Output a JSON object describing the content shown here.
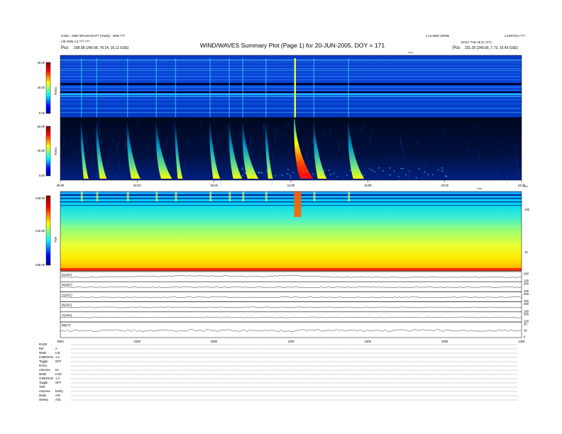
{
  "header": {
    "title": "WIND/WAVES Summary Plot (Page 1) for 20-JUN-2005, DOY = 171",
    "left_line1": "0.030 = 2000 SPACECRAFT (Yearly) - 2005 ???",
    "left_line2": "A/E 2005 2.3 ??? ???",
    "left_pos_label": "Pos",
    "left_pos_value": "238.08 (240.58, 78.14, 16.11 GSE)",
    "right_line1": "1.13 WED 22FEB",
    "right_line1b": "L3 EPOCH ???",
    "right_line2": "DAILY TUE 28 (3, 3??)",
    "right_pos_label": "Pos",
    "right_pos_value": "231.25 (240.66, 7.73, 16.43 GSE)"
  },
  "panels": {
    "rad2": {
      "label": "RAD2",
      "units": "MHz"
    },
    "rad1": {
      "label": "RAD1",
      "units": "kHz"
    },
    "tnr": {
      "label": "TNR",
      "units": "kHz"
    }
  },
  "plot_labels": {
    "rad1_top": "???",
    "tnr_top": "???",
    "rad1_right_top": "???"
  },
  "chart_data": [
    {
      "type": "heatmap",
      "name": "RAD2",
      "ylabel": "RAD2",
      "colorbar_ticks": [
        "40.00",
        "20.00",
        "0.00"
      ],
      "colorbar_range": [
        0,
        40
      ],
      "colors": [
        "#000080",
        "#0000ff",
        "#00ffff",
        "#ffff00",
        "#ff0000",
        "#800000"
      ]
    },
    {
      "type": "heatmap",
      "name": "RAD1",
      "ylabel": "RAD1",
      "colorbar_ticks": [
        "60.00",
        "30.00",
        "0.00"
      ],
      "colorbar_range": [
        0,
        60
      ],
      "x_ticks": [
        "00:00",
        "04:00",
        "08:00",
        "12:00",
        "16:00",
        "20:00",
        "24:00"
      ],
      "burst_hours": [
        1.1,
        1.9,
        3.5,
        5.0,
        6.0,
        7.8,
        8.8,
        9.5,
        10.7,
        12.2,
        13.2,
        15.0
      ]
    },
    {
      "type": "heatmap",
      "name": "TNR",
      "ylabel": "TNR",
      "colorbar_ticks": [
        "-130.00",
        "-142.50",
        "-155.00"
      ],
      "colorbar_range": [
        -155,
        -130
      ],
      "right_ticks": [
        "100",
        "10"
      ]
    },
    {
      "type": "line",
      "name": "stack",
      "rows": [
        {
          "label": "E(ADC)",
          "right": [
            "200",
            "100"
          ]
        },
        {
          "label": "D(ADC)",
          "right": [
            "200",
            "100"
          ]
        },
        {
          "label": "C(ADC)",
          "right": [
            "200",
            "100"
          ]
        },
        {
          "label": "B(ADC)",
          "right": [
            "200",
            "100"
          ]
        },
        {
          "label": "A(ADC)",
          "right": [
            "200",
            "100"
          ]
        },
        {
          "label": "|B|(nT)",
          "right": [
            "20",
            "10",
            "0"
          ]
        }
      ],
      "x_ticks": [
        "0000",
        "0400",
        "0800",
        "1200",
        "1600",
        "2000",
        "2400"
      ]
    }
  ],
  "footer": {
    "groups": [
      {
        "name": "RAD2",
        "rows": [
          [
            "Ref",
            "A"
          ],
          [
            "Mode",
            "LIN"
          ],
          [
            "2:MEDIAN",
            "1.2"
          ],
          [
            "Toggle",
            "OFF"
          ]
        ]
      },
      {
        "name": "RAD1",
        "rows": [
          [
            "Antenna",
            "Ex"
          ],
          [
            "Mode",
            "LOG"
          ],
          [
            "3:MEDIAN",
            "1.4"
          ],
          [
            "Toggle",
            "OFF"
          ]
        ]
      },
      {
        "name": "TNR",
        "rows": [
          [
            "Antenna",
            "Ex/Ey"
          ],
          [
            "Mode",
            "A/D"
          ],
          [
            "Sweep",
            "ADL"
          ]
        ]
      }
    ]
  }
}
